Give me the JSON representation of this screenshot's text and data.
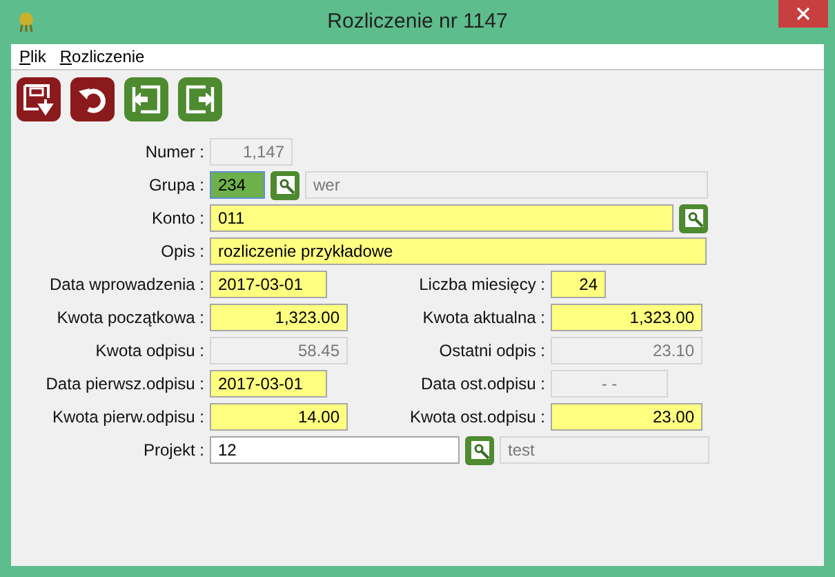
{
  "window": {
    "title": "Rozliczenie nr 1147"
  },
  "menu": [
    {
      "label": "Plik"
    },
    {
      "label": "Rozliczenie"
    }
  ],
  "toolbar": [
    {
      "kind": "save"
    },
    {
      "kind": "undo"
    },
    {
      "kind": "prev"
    },
    {
      "kind": "next"
    }
  ],
  "rows": [
    {
      "left": {
        "label": "Numer :",
        "value": "1,147",
        "kind": "number",
        "readonly": true,
        "required": false,
        "focused": false
      }
    },
    {
      "left": {
        "label": "Grupa :",
        "value": "234",
        "kind": "text",
        "readonly": false,
        "required": true,
        "focused": true,
        "lookup": true,
        "description": "wer"
      }
    },
    {
      "left": {
        "label": "Konto :",
        "value": "011",
        "kind": "text",
        "readonly": false,
        "required": true,
        "focused": false,
        "lookup": true
      }
    },
    {
      "left": {
        "label": "Opis :",
        "value": "rozliczenie przykładowe",
        "kind": "text",
        "readonly": false,
        "required": true,
        "focused": false
      }
    },
    {
      "left": {
        "label": "Data wprowadzenia :",
        "value": "2017-03-01",
        "kind": "text",
        "readonly": false,
        "required": true,
        "focused": false
      },
      "right": {
        "label": "Liczba miesięcy :",
        "value": "24",
        "kind": "number",
        "readonly": false,
        "required": true,
        "focused": false
      }
    },
    {
      "left": {
        "label": "Kwota początkowa :",
        "value": "1,323.00",
        "kind": "number",
        "readonly": false,
        "required": true,
        "focused": false
      },
      "right": {
        "label": "Kwota aktualna :",
        "value": "1,323.00",
        "kind": "number",
        "readonly": false,
        "required": true,
        "focused": false
      }
    },
    {
      "left": {
        "label": "Kwota odpisu :",
        "value": "58.45",
        "kind": "number",
        "readonly": true,
        "required": false,
        "focused": false
      },
      "right": {
        "label": "Ostatni odpis :",
        "value": "23.10",
        "kind": "number",
        "readonly": true,
        "required": false,
        "focused": false
      }
    },
    {
      "left": {
        "label": "Data pierwsz.odpisu :",
        "value": "2017-03-01",
        "kind": "text",
        "readonly": false,
        "required": true,
        "focused": false
      },
      "right": {
        "label": "Data ost.odpisu :",
        "value": "- -",
        "kind": "mask",
        "readonly": true,
        "required": false,
        "focused": false
      }
    },
    {
      "left": {
        "label": "Kwota pierw.odpisu :",
        "value": "14.00",
        "kind": "number",
        "readonly": false,
        "required": true,
        "focused": false
      },
      "right": {
        "label": "Kwota ost.odpisu :",
        "value": "23.00",
        "kind": "number",
        "readonly": false,
        "required": true,
        "focused": false
      }
    },
    {
      "left": {
        "label": "Projekt :",
        "value": "12",
        "kind": "text",
        "readonly": false,
        "required": false,
        "focused": false,
        "lookup": true,
        "description": "test"
      }
    }
  ]
}
